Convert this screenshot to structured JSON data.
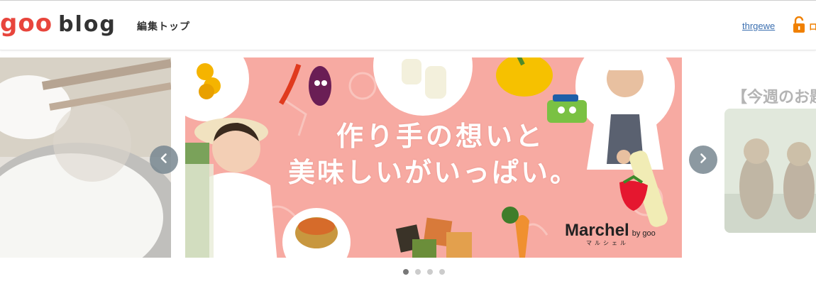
{
  "header": {
    "logo_goo": "goo",
    "logo_blog": "blog",
    "edit_top": "編集トップ",
    "username": "thrgewe",
    "logout_label": "ロ"
  },
  "carousel": {
    "main": {
      "headline_line1": "作り手の想いと",
      "headline_line2": "美味しいがいっぱい。",
      "brand_name": "Marchel",
      "brand_by": "by goo",
      "brand_kana": "マルシェル"
    },
    "next": {
      "title": "【今週のお題"
    },
    "dots_count": 4,
    "active_dot": 1
  },
  "colors": {
    "accent_red": "#e8453c",
    "link_blue": "#3b6fb0",
    "logout_orange": "#f08000",
    "banner_pink": "#f7aaa2",
    "arrow_gray": "#78878f"
  },
  "icons": {
    "logout": "padlock-open-icon",
    "prev": "chevron-left-icon",
    "next": "chevron-right-icon"
  }
}
